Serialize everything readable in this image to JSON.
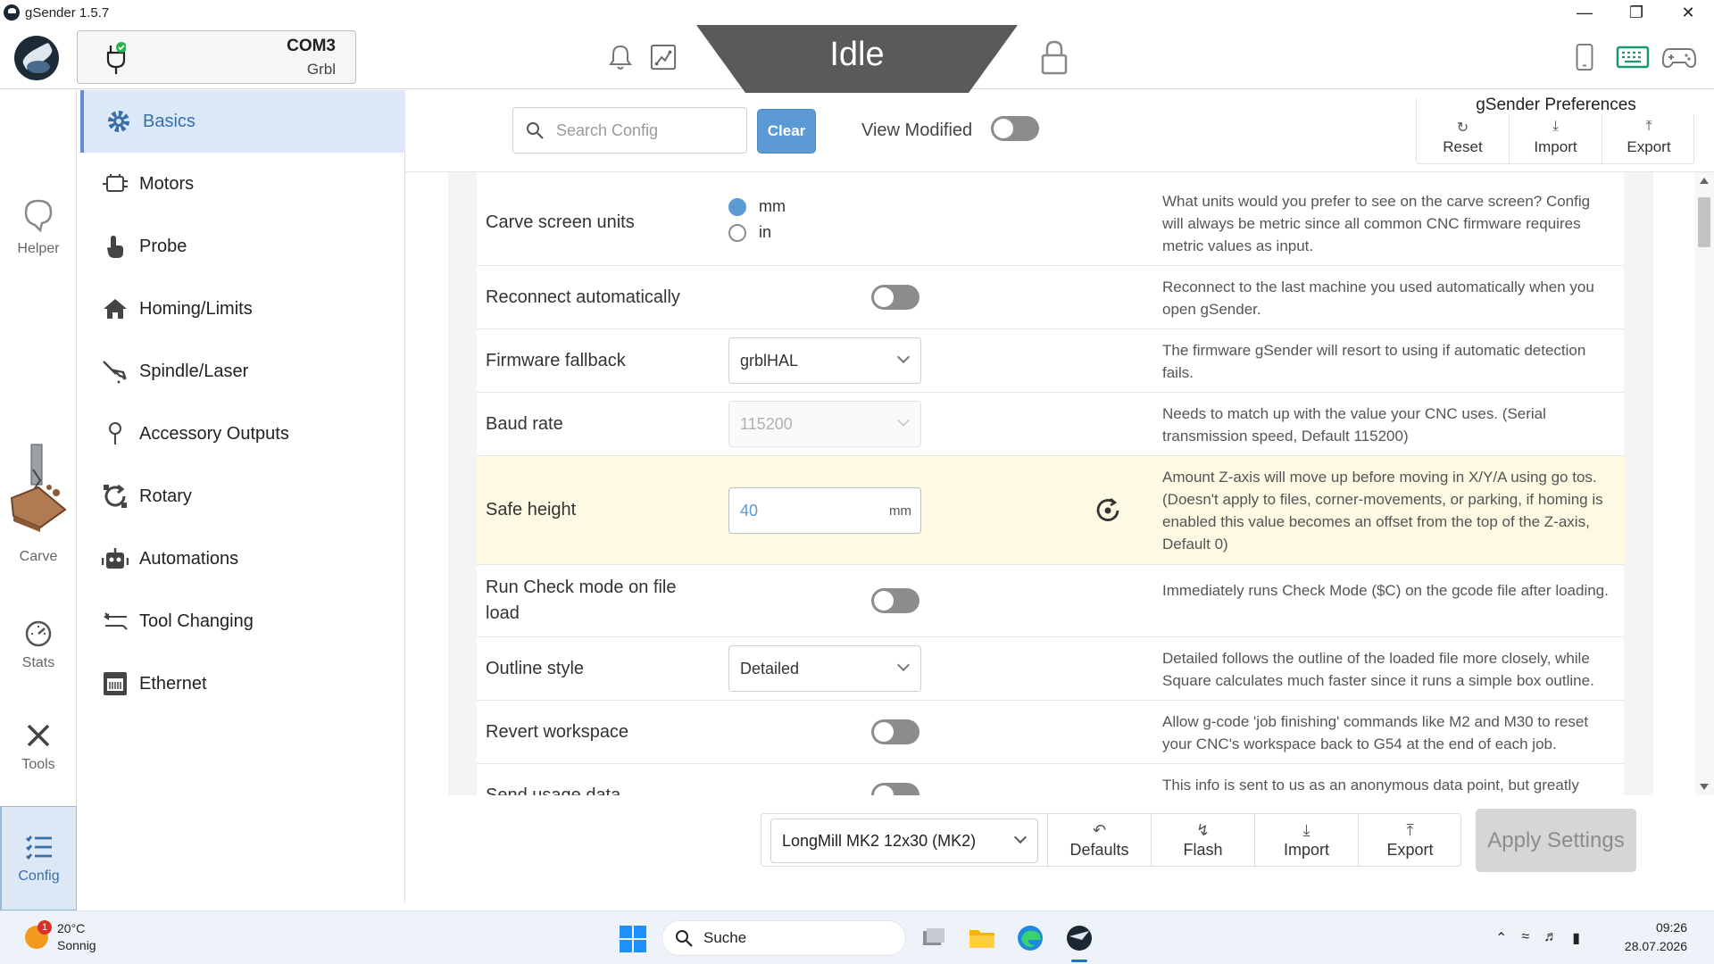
{
  "window": {
    "title": "gSender 1.5.7"
  },
  "connection": {
    "port": "COM3",
    "firmware": "Grbl"
  },
  "status": {
    "state": "Idle"
  },
  "left_rail": [
    {
      "label": "Helper",
      "icon": "helper-icon"
    },
    {
      "label": "Carve",
      "icon": "carve-icon"
    },
    {
      "label": "Stats",
      "icon": "stats-icon"
    },
    {
      "label": "Tools",
      "icon": "tools-icon"
    },
    {
      "label": "Config",
      "icon": "config-icon",
      "active": true
    }
  ],
  "sub_nav": [
    {
      "label": "Basics",
      "icon": "gear-icon",
      "active": true
    },
    {
      "label": "Motors",
      "icon": "motor-icon"
    },
    {
      "label": "Probe",
      "icon": "probe-icon"
    },
    {
      "label": "Homing/Limits",
      "icon": "home-icon"
    },
    {
      "label": "Spindle/Laser",
      "icon": "spindle-icon"
    },
    {
      "label": "Accessory Outputs",
      "icon": "accessory-icon"
    },
    {
      "label": "Rotary",
      "icon": "rotary-icon"
    },
    {
      "label": "Automations",
      "icon": "robot-icon"
    },
    {
      "label": "Tool Changing",
      "icon": "tool-change-icon"
    },
    {
      "label": "Ethernet",
      "icon": "ethernet-icon"
    }
  ],
  "toolbar": {
    "search_placeholder": "Search Config",
    "clear_label": "Clear",
    "view_modified_label": "View Modified",
    "view_modified_on": false
  },
  "preferences": {
    "title": "gSender Preferences",
    "reset_label": "Reset",
    "import_label": "Import",
    "export_label": "Export"
  },
  "settings": {
    "carve_units": {
      "label": "Carve screen units",
      "options": [
        "mm",
        "in"
      ],
      "selected": "mm",
      "description": "What units would you prefer to see on the carve screen? Config will always be metric since all common CNC firmware requires metric values as input."
    },
    "reconnect": {
      "label": "Reconnect automatically",
      "on": false,
      "description": "Reconnect to the last machine you used automatically when you open gSender."
    },
    "firmware_fallback": {
      "label": "Firmware fallback",
      "value": "grblHAL",
      "description": "The firmware gSender will resort to using if automatic detection fails."
    },
    "baud_rate": {
      "label": "Baud rate",
      "value": "115200",
      "disabled": true,
      "description": "Needs to match up with the value your CNC uses. (Serial transmission speed, Default 115200)"
    },
    "safe_height": {
      "label": "Safe height",
      "value": "40",
      "unit": "mm",
      "modified": true,
      "description": "Amount Z-axis will move up before moving in X/Y/A using go tos. (Doesn't apply to files, corner-movements, or parking, if homing is enabled this value becomes an offset from the top of the Z-axis, Default 0)"
    },
    "check_mode": {
      "label": "Run Check mode on file load",
      "on": false,
      "description": "Immediately runs Check Mode ($C) on the gcode file after loading."
    },
    "outline_style": {
      "label": "Outline style",
      "value": "Detailed",
      "description": "Detailed follows the outline of the loaded file more closely, while Square calculates much faster since it runs a simple box outline."
    },
    "revert_workspace": {
      "label": "Revert workspace",
      "on": false,
      "description": "Allow g-code 'job finishing' commands like M2 and M30 to reset your CNC's workspace back to G54 at the end of each job."
    },
    "usage_data": {
      "label": "Send usage data",
      "on": false,
      "description": "This info is sent to us as an anonymous data point, but greatly"
    }
  },
  "bottom_bar": {
    "machine": "LongMill MK2 12x30 (MK2)",
    "defaults_label": "Defaults",
    "flash_label": "Flash",
    "import_label": "Import",
    "export_label": "Export",
    "apply_label": "Apply Settings"
  },
  "taskbar": {
    "temperature": "20°C",
    "weather": "Sonnig",
    "weather_badge": "1",
    "search_label": "Suche",
    "time": "09:26",
    "date": "28.07.2026"
  },
  "colors": {
    "accent": "#5c9ad6",
    "status_bg": "#5a5a5a",
    "highlight": "#fdf9e3"
  }
}
